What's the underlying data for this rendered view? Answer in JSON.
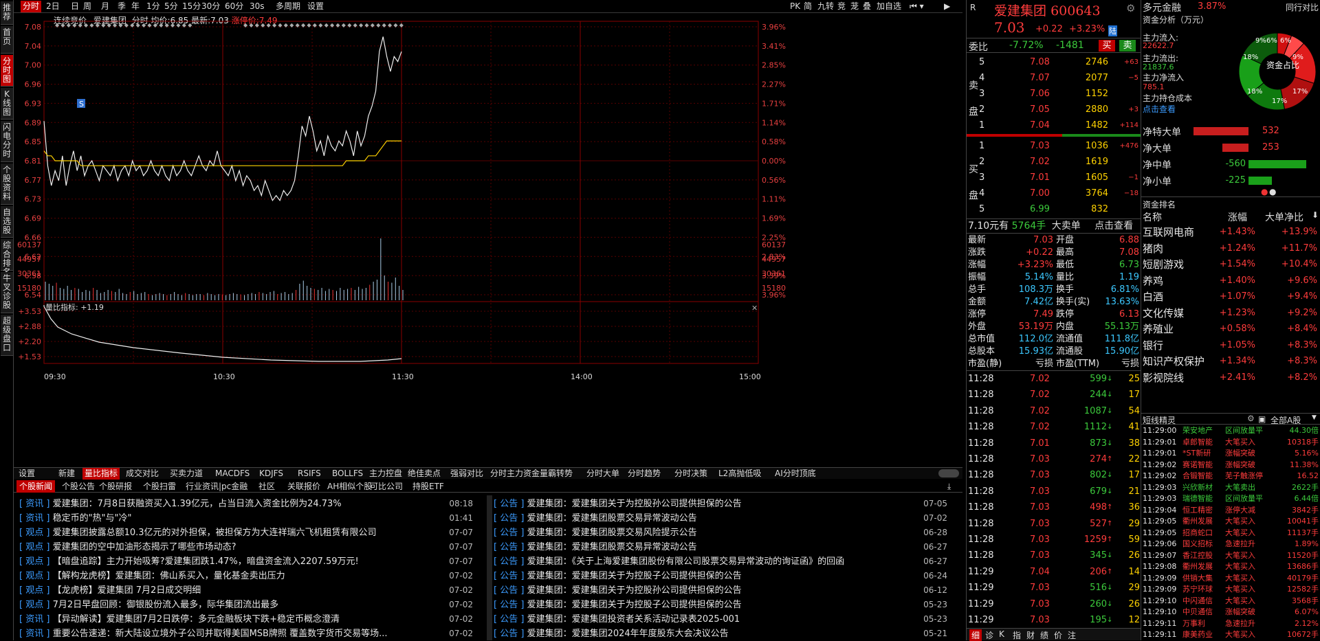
{
  "left_tabs": [
    "推荐",
    "首页",
    "分时图",
    "K线图",
    "闪电分时",
    "个股资料",
    "自选股",
    "综合排名",
    "牛叉诊股",
    "超级盘口"
  ],
  "toolbar": {
    "items": [
      "分时",
      "2日",
      "日",
      "周",
      "月",
      "季",
      "年",
      "1分",
      "5分",
      "15分",
      "30分",
      "60分",
      "30s",
      "多周期",
      "设置"
    ],
    "right_items": [
      "PK",
      "简",
      "九转",
      "竞",
      "茏",
      "叠",
      "加自选"
    ]
  },
  "chart_header": {
    "name": "连续竞价",
    "stock": "爱建集团",
    "type": "分时",
    "avg_label": "均价:",
    "avg": "6.85",
    "last_label": "最新:",
    "last": "7.03",
    "limit_label": "涨停价:",
    "limit": "7.49"
  },
  "chart_data": {
    "type": "line",
    "price_ticks": [
      "7.08",
      "7.04",
      "7.00",
      "6.96",
      "6.93",
      "6.89",
      "6.85",
      "6.81",
      "6.77",
      "6.73",
      "6.69",
      "6.66",
      "6.62",
      "6.58",
      "6.54"
    ],
    "pct_ticks": [
      "3.96%",
      "3.41%",
      "2.85%",
      "2.27%",
      "1.71%",
      "1.14%",
      "0.58%",
      "0.00%",
      "0.56%",
      "1.11%",
      "1.69%",
      "2.25%",
      "2.83%",
      "3.39%",
      "3.96%"
    ],
    "volume_ticks": [
      "60137",
      "44957",
      "30361",
      "15180"
    ],
    "time_ticks": [
      "09:30",
      "10:30",
      "11:30",
      "14:00",
      "15:00"
    ],
    "ratio_label": "量比指标: +1.19",
    "ratio_ticks": [
      "+3.53",
      "+2.88",
      "+2.20",
      "+1.53"
    ],
    "marker": "S",
    "ylim": [
      6.54,
      7.08
    ],
    "price": [
      6.89,
      6.8,
      6.76,
      6.79,
      6.77,
      6.82,
      6.76,
      6.8,
      6.83,
      6.79,
      6.82,
      6.78,
      6.8,
      6.81,
      6.79,
      6.77,
      6.8,
      6.79,
      6.78,
      6.8,
      6.77,
      6.79,
      6.8,
      6.78,
      6.81,
      6.79,
      6.8,
      6.78,
      6.79,
      6.81,
      6.79,
      6.78,
      6.8,
      6.78,
      6.77,
      6.8,
      6.78,
      6.79,
      6.81,
      6.79,
      6.78,
      6.8,
      6.82,
      6.8,
      6.79,
      6.81,
      6.8,
      6.83,
      6.8,
      6.79,
      6.78,
      6.8,
      6.77,
      6.79,
      6.76,
      6.78,
      6.77,
      6.75,
      6.76,
      6.74,
      6.77,
      6.75,
      6.73,
      6.74,
      6.73,
      6.75,
      6.74,
      6.75,
      6.77,
      6.82,
      6.88,
      6.86,
      6.9,
      6.87,
      6.83,
      6.85,
      6.82,
      6.86,
      6.84,
      6.83,
      6.85,
      6.84,
      6.87,
      6.85,
      6.82,
      6.87,
      6.84,
      6.86,
      6.9,
      6.92,
      6.95,
      7.03,
      7.06,
      7.02,
      6.99,
      7.02,
      7.01,
      7.03
    ],
    "avg": [
      6.83,
      6.82,
      6.82,
      6.81,
      6.81,
      6.81,
      6.81,
      6.81,
      6.81,
      6.81,
      6.8,
      6.8,
      6.8,
      6.8,
      6.8,
      6.8,
      6.8,
      6.8,
      6.8,
      6.8,
      6.8,
      6.8,
      6.8,
      6.8,
      6.8,
      6.8,
      6.8,
      6.8,
      6.8,
      6.8,
      6.8,
      6.8,
      6.8,
      6.8,
      6.8,
      6.8,
      6.8,
      6.8,
      6.8,
      6.8,
      6.8,
      6.8,
      6.8,
      6.8,
      6.8,
      6.8,
      6.8,
      6.8,
      6.8,
      6.8,
      6.8,
      6.8,
      6.8,
      6.8,
      6.8,
      6.8,
      6.8,
      6.8,
      6.8,
      6.8,
      6.8,
      6.8,
      6.8,
      6.8,
      6.8,
      6.8,
      6.8,
      6.8,
      6.8,
      6.8,
      6.8,
      6.8,
      6.8,
      6.8,
      6.8,
      6.8,
      6.8,
      6.8,
      6.8,
      6.8,
      6.8,
      6.8,
      6.81,
      6.81,
      6.81,
      6.81,
      6.81,
      6.81,
      6.82,
      6.82,
      6.82,
      6.83,
      6.84,
      6.85,
      6.85,
      6.85,
      6.85,
      6.85
    ]
  },
  "quote_header": {
    "market": "R",
    "name": "爱建集团",
    "code": "600643",
    "price": "7.03",
    "chg": "+0.22",
    "pct": "+3.23%",
    "tag": "陆"
  },
  "order_ratio": {
    "label": "委比",
    "ratio": "-7.72%",
    "diff": "-1481",
    "buy": "买",
    "sell": "卖"
  },
  "asks": [
    {
      "lv": "5",
      "p": "7.08",
      "v": "2746",
      "d": "+63"
    },
    {
      "lv": "4",
      "p": "7.07",
      "v": "2077",
      "d": "−5"
    },
    {
      "lv": "3",
      "p": "7.06",
      "v": "1152",
      "d": ""
    },
    {
      "lv": "2",
      "p": "7.05",
      "v": "2880",
      "d": "+3"
    },
    {
      "lv": "1",
      "p": "7.04",
      "v": "1482",
      "d": "+114"
    }
  ],
  "bids": [
    {
      "lv": "1",
      "p": "7.03",
      "v": "1036",
      "d": "+476"
    },
    {
      "lv": "2",
      "p": "7.02",
      "v": "1619",
      "d": ""
    },
    {
      "lv": "3",
      "p": "7.01",
      "v": "1605",
      "d": "−1"
    },
    {
      "lv": "4",
      "p": "7.00",
      "v": "3764",
      "d": "−18"
    },
    {
      "lv": "5",
      "p": "6.99",
      "v": "832",
      "d": ""
    }
  ],
  "ask_label": "卖盘",
  "bid_label": "买盘",
  "big_order": {
    "price": "7.10元有",
    "vol": "5764手",
    "label": "大卖单",
    "link": "点击查看"
  },
  "stats": [
    [
      "最新",
      "7.03",
      "开盘",
      "6.88"
    ],
    [
      "涨跌",
      "+0.22",
      "最高",
      "7.08"
    ],
    [
      "涨幅",
      "+3.23%",
      "最低",
      "6.73"
    ],
    [
      "振幅",
      "5.14%",
      "量比",
      "1.19"
    ],
    [
      "总手",
      "108.3万",
      "换手",
      "6.81%"
    ],
    [
      "金额",
      "7.42亿",
      "换手(实)",
      "13.63%"
    ],
    [
      "涨停",
      "7.49",
      "跌停",
      "6.13"
    ],
    [
      "外盘",
      "53.19万",
      "内盘",
      "55.13万"
    ],
    [
      "总市值",
      "112.0亿",
      "流通值",
      "111.8亿"
    ],
    [
      "总股本",
      "15.93亿",
      "流通股",
      "15.90亿"
    ],
    [
      "市盈(静)",
      "亏损",
      "市盈(TTM)",
      "亏损"
    ]
  ],
  "ticks": [
    [
      "11:28",
      "7.02",
      "599",
      "25"
    ],
    [
      "11:28",
      "7.02",
      "244",
      "17"
    ],
    [
      "11:28",
      "7.02",
      "1087",
      "54"
    ],
    [
      "11:28",
      "7.02",
      "1112",
      "41"
    ],
    [
      "11:28",
      "7.01",
      "873",
      "38"
    ],
    [
      "11:28",
      "7.03",
      "274",
      "22"
    ],
    [
      "11:28",
      "7.03",
      "802",
      "17"
    ],
    [
      "11:28",
      "7.03",
      "679",
      "21"
    ],
    [
      "11:28",
      "7.03",
      "498",
      "36"
    ],
    [
      "11:28",
      "7.03",
      "527",
      "29"
    ],
    [
      "11:28",
      "7.03",
      "1259",
      "59"
    ],
    [
      "11:28",
      "7.03",
      "345",
      "26"
    ],
    [
      "11:29",
      "7.04",
      "206",
      "14"
    ],
    [
      "11:29",
      "7.03",
      "516",
      "29"
    ],
    [
      "11:29",
      "7.03",
      "260",
      "26"
    ],
    [
      "11:29",
      "7.03",
      "195",
      "12"
    ]
  ],
  "bottom_right_tabs": [
    "细",
    "诊",
    "K",
    "指",
    "财",
    "绩",
    "价",
    "注"
  ],
  "sector": {
    "name": "多元金融",
    "pct": "3.87%",
    "link": "同行对比"
  },
  "fund": {
    "title": "资金分析（万元）",
    "inflow_l": "主力流入:",
    "inflow": "22622.7",
    "outflow_l": "主力流出:",
    "outflow": "21837.6",
    "net_l": "主力净流入",
    "net": "785.1",
    "cost_l": "主力持仓成本",
    "cost_link": "点击查看",
    "donut_label": "资金占比",
    "slices": [
      "6%",
      "6%",
      "9%",
      "17%",
      "17%",
      "18%",
      "18%",
      "9%"
    ]
  },
  "net_flow": [
    {
      "l": "净特大单",
      "v": "532",
      "s": "red"
    },
    {
      "l": "净大单",
      "v": "253",
      "s": "red"
    },
    {
      "l": "净中单",
      "v": "-560",
      "s": "grn"
    },
    {
      "l": "净小单",
      "v": "-225",
      "s": "grn"
    }
  ],
  "rank": {
    "title": "资金排名",
    "cols": [
      "名称",
      "涨幅",
      "大单净比"
    ],
    "rows": [
      [
        "互联网电商",
        "+1.43%",
        "+13.9%"
      ],
      [
        "猪肉",
        "+1.24%",
        "+11.7%"
      ],
      [
        "短剧游戏",
        "+1.54%",
        "+10.4%"
      ],
      [
        "养鸡",
        "+1.40%",
        "+9.6%"
      ],
      [
        "白酒",
        "+1.07%",
        "+9.4%"
      ],
      [
        "文化传媒",
        "+1.23%",
        "+9.2%"
      ],
      [
        "养殖业",
        "+0.58%",
        "+8.4%"
      ],
      [
        "银行",
        "+1.05%",
        "+8.3%"
      ],
      [
        "知识产权保护",
        "+1.34%",
        "+8.3%"
      ],
      [
        "影视院线",
        "+2.41%",
        "+8.2%"
      ]
    ]
  },
  "sprite": {
    "title": "短线精灵",
    "filter": "全部A股",
    "rows": [
      [
        "11:29:00",
        "荣安地产",
        "区间放量平",
        "44.30倍"
      ],
      [
        "11:29:01",
        "卓郎智能",
        "大笔买入",
        "10318手"
      ],
      [
        "11:29:01",
        "*ST新研",
        "涨幅突破",
        "5.16%"
      ],
      [
        "11:29:02",
        "赛诺智能",
        "涨幅突破",
        "11.38%"
      ],
      [
        "11:29:02",
        "合锻智能",
        "芜子触涨停",
        "16.52"
      ],
      [
        "11:29:03",
        "兴欣新材",
        "大笔卖出",
        "2622手"
      ],
      [
        "11:29:03",
        "瑞德智能",
        "区间放量平",
        "6.44倍"
      ],
      [
        "11:29:04",
        "恒工精密",
        "涨停大减",
        "3842手"
      ],
      [
        "11:29:05",
        "衢州发展",
        "大笔买入",
        "10041手"
      ],
      [
        "11:29:05",
        "招商蛇口",
        "大笔买入",
        "11137手"
      ],
      [
        "11:29:06",
        "国义招标",
        "急速拉升",
        "1.89%"
      ],
      [
        "11:29:07",
        "香江控股",
        "大笔买入",
        "11520手"
      ],
      [
        "11:29:08",
        "衢州发展",
        "大笔买入",
        "13686手"
      ],
      [
        "11:29:09",
        "供销大集",
        "大笔买入",
        "40179手"
      ],
      [
        "11:29:09",
        "苏宁环球",
        "大笔买入",
        "12582手"
      ],
      [
        "11:29:10",
        "中闪通信",
        "大笔买入",
        "3568手"
      ],
      [
        "11:29:10",
        "中贝通信",
        "涨幅突破",
        "6.07%"
      ],
      [
        "11:29:11",
        "万事利",
        "急速拉升",
        "2.12%"
      ],
      [
        "11:29:11",
        "康美药业",
        "大笔买入",
        "10672手"
      ]
    ]
  },
  "bottom_tabs": [
    "设置",
    "新建",
    "量比指标",
    "成交对比",
    "买卖力道",
    "MACDFS",
    "KDJFS",
    "RSIFS",
    "BOLLFS",
    "主力控盘",
    "绝佳卖点",
    "强弱对比",
    "分时主力资金",
    "量霸转势",
    "分时大单",
    "分时趋势",
    "分时决策",
    "L2高抛低吸",
    "AI分时顶底"
  ],
  "news_tabs": [
    "个股新闻",
    "个股公告",
    "个股研报",
    "个股扫雷",
    "行业资讯|pc金融",
    "社区",
    "关联报价",
    "AH相似个股",
    "可比公司",
    "持股ETF"
  ],
  "news_left": [
    [
      "资讯",
      "爱建集团：7月8日获融资买入1.39亿元，占当日流入资金比例为24.73%",
      "08:18"
    ],
    [
      "资讯",
      "稳定币的\"热\"与\"冷\"",
      "01:41"
    ],
    [
      "观点",
      "爱建集团披露总额10.3亿元的对外担保，被担保方为大连祥瑞六飞机租赁有限公司",
      "07-07"
    ],
    [
      "观点",
      "爱建集团的空中加油形态揭示了哪些市场动态?",
      "07-07"
    ],
    [
      "观点",
      "【暗盘追踪】主力开始吸筹?爱建集团跌1.47%，暗盘资金流入2207.59万元!",
      "07-07"
    ],
    [
      "观点",
      "【解构龙虎榜】爱建集团：佛山系买入，量化基金卖出压力",
      "07-02"
    ],
    [
      "观点",
      "【龙虎榜】爱建集团 7月2日成交明细",
      "07-02"
    ],
    [
      "观点",
      "7月2日早盘回顾：御银股份流入最多，际华集团流出最多",
      "07-02"
    ],
    [
      "资讯",
      "【异动解读】爱建集团7月2日跌停：多元金融板块下跌+稳定币概念澄清",
      "07-02"
    ],
    [
      "资讯",
      "重要公告速递：新大陆设立境外子公司并取得美国MSB牌照 覆盖数字货币交易等场...",
      "07-02"
    ]
  ],
  "news_right": [
    [
      "公告",
      "爱建集团：爱建集团关于为控股孙公司提供担保的公告",
      "07-05"
    ],
    [
      "公告",
      "爱建集团：爱建集团股票交易异常波动公告",
      "07-02"
    ],
    [
      "公告",
      "爱建集团：爱建集团股票交易风险提示公告",
      "06-28"
    ],
    [
      "公告",
      "爱建集团：爱建集团股票交易异常波动公告",
      "06-27"
    ],
    [
      "公告",
      "爱建集团：《关于上海爱建集团股份有限公司股票交易异常波动的询证函》的回函",
      "06-27"
    ],
    [
      "公告",
      "爱建集团：爱建集团关于为控股子公司提供担保的公告",
      "06-24"
    ],
    [
      "公告",
      "爱建集团：爱建集团关于为控股孙公司提供担保的公告",
      "06-12"
    ],
    [
      "公告",
      "爱建集团：爱建集团关于为控股子公司提供担保的公告",
      "05-23"
    ],
    [
      "公告",
      "爱建集团：爱建集团投资者关系活动记录表2025-001",
      "05-23"
    ],
    [
      "公告",
      "爱建集团：爱建集团2024年年度股东大会决议公告",
      "05-21"
    ]
  ]
}
